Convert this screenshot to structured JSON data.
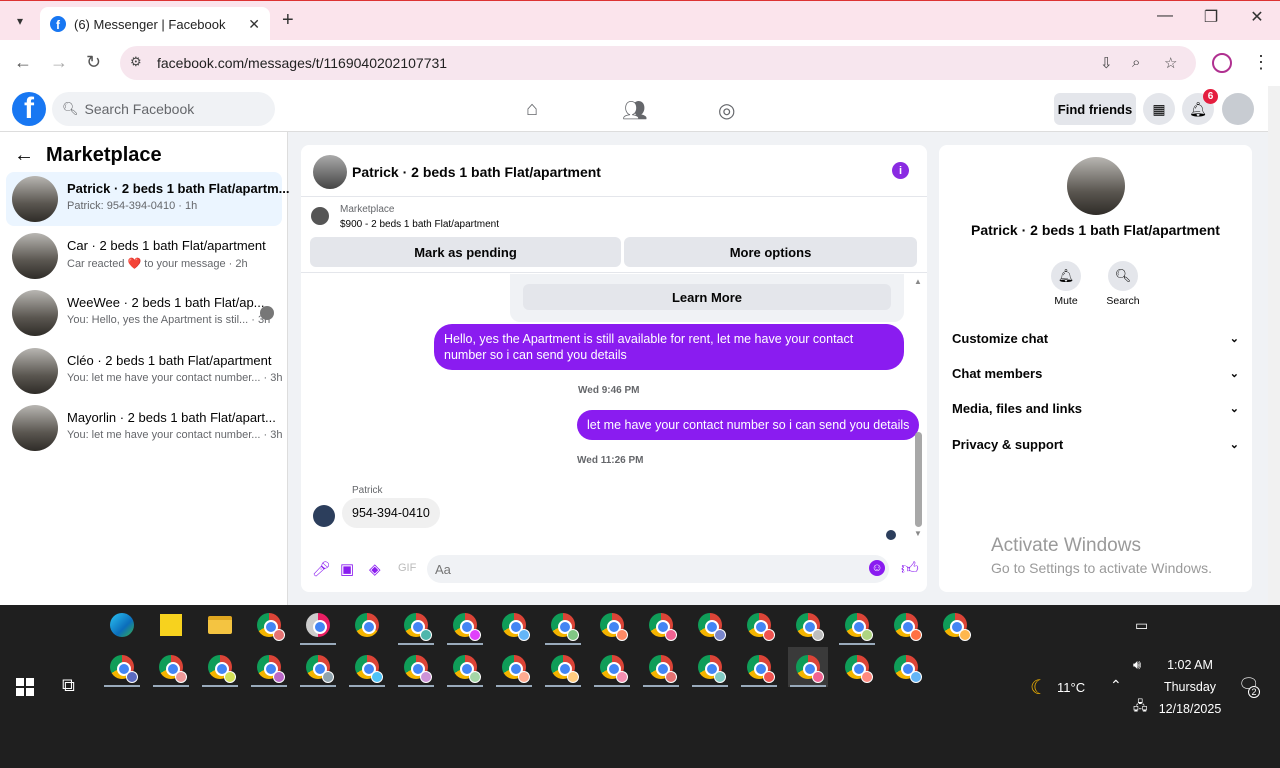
{
  "browser": {
    "tab_title": "(6) Messenger | Facebook",
    "url": "facebook.com/messages/t/1169040202107731"
  },
  "header": {
    "search_placeholder": "Search Facebook",
    "find_friends": "Find friends",
    "notification_count": "6"
  },
  "left": {
    "title": "Marketplace",
    "conversations": [
      {
        "name": "Patrick · 2 beds 1 bath Flat/apartm...",
        "sub": "Patrick: 954-394-0410 · 1h",
        "active": true
      },
      {
        "name": "Car · 2 beds 1 bath Flat/apartment",
        "sub": "Car reacted ❤️ to your message · 2h",
        "active": false
      },
      {
        "name": "WeeWee · 2 beds 1 bath Flat/ap...",
        "sub": "You: Hello, yes the Apartment is stil... · 3h",
        "active": false
      },
      {
        "name": "Cléo · 2 beds 1 bath Flat/apartment",
        "sub": "You: let me have your contact number... · 3h",
        "active": false
      },
      {
        "name": "Mayorlin · 2 beds 1 bath Flat/apart...",
        "sub": "You: let me have your contact number... · 3h",
        "active": false
      }
    ]
  },
  "chat": {
    "header_name": "Patrick · 2 beds 1 bath Flat/apartment",
    "marketplace_label": "Marketplace",
    "listing": "$900 - 2 beds 1 bath Flat/apartment",
    "mark_pending": "Mark as pending",
    "more_options": "More options",
    "learn_more": "Learn More",
    "msg1": "Hello, yes the Apartment is still available for rent, let me have your contact number so i can send you details",
    "time1": "Wed 9:46 PM",
    "msg2": "let me have your contact number so i can send you details",
    "time2": "Wed 11:26 PM",
    "sender": "Patrick",
    "reply": "954-394-0410",
    "composer_placeholder": "Aa"
  },
  "right": {
    "name": "Patrick · 2 beds 1 bath Flat/apartment",
    "mute": "Mute",
    "search": "Search",
    "rows": [
      "Customize chat",
      "Chat members",
      "Media, files and links",
      "Privacy & support"
    ]
  },
  "watermark": {
    "line1": "Activate Windows",
    "line2": "Go to Settings to activate Windows."
  },
  "taskbar": {
    "weather": "11°C",
    "time": "1:02 AM",
    "day": "Thursday",
    "date": "12/18/2025",
    "notif_count": "2"
  },
  "colors": {
    "messenger_purple": "#8a1cf0",
    "facebook_blue": "#1877f2"
  }
}
